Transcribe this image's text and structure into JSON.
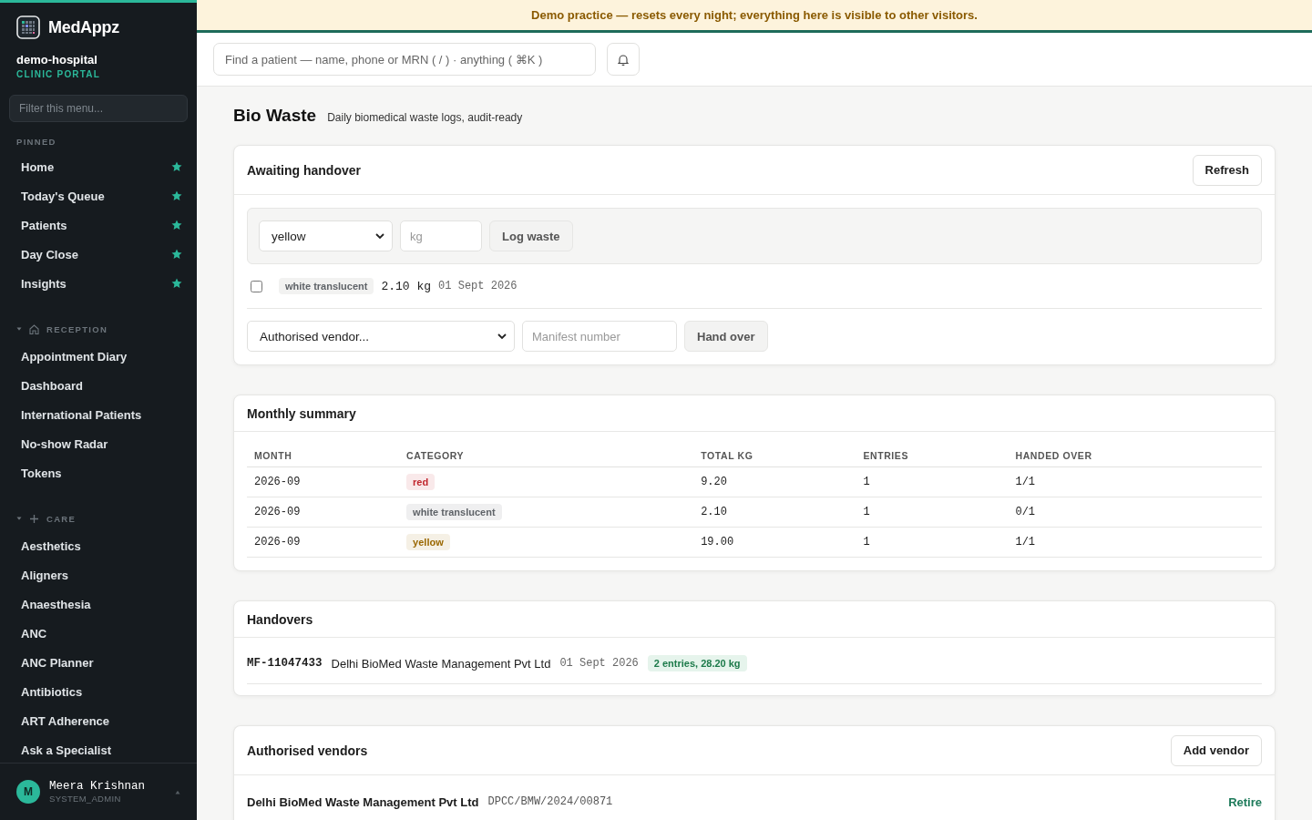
{
  "brand": {
    "name": "MedAppz"
  },
  "sidebar": {
    "org": "demo-hospital",
    "portal": "CLINIC PORTAL",
    "filter_placeholder": "Filter this menu...",
    "pinned_label": "PINNED",
    "pinned": [
      {
        "label": "Home"
      },
      {
        "label": "Today's Queue"
      },
      {
        "label": "Patients"
      },
      {
        "label": "Day Close"
      },
      {
        "label": "Insights"
      }
    ],
    "sections": [
      {
        "title": "RECEPTION",
        "kind": "home",
        "expanded": true,
        "items": [
          {
            "label": "Appointment Diary"
          },
          {
            "label": "Dashboard"
          },
          {
            "label": "International Patients"
          },
          {
            "label": "No-show Radar"
          },
          {
            "label": "Tokens"
          }
        ]
      },
      {
        "title": "CARE",
        "kind": "plus",
        "expanded": true,
        "items": [
          {
            "label": "Aesthetics"
          },
          {
            "label": "Aligners"
          },
          {
            "label": "Anaesthesia"
          },
          {
            "label": "ANC"
          },
          {
            "label": "ANC Planner"
          },
          {
            "label": "Antibiotics"
          },
          {
            "label": "ART Adherence"
          },
          {
            "label": "Ask a Specialist"
          }
        ]
      }
    ],
    "user": {
      "initial": "M",
      "name": "Meera Krishnan",
      "role": "SYSTEM_ADMIN"
    }
  },
  "banner": "Demo practice — resets every night; everything here is visible to other visitors.",
  "topbar": {
    "search_placeholder": "Find a patient — name, phone or MRN ( / ) · anything ( ⌘K )"
  },
  "page": {
    "title": "Bio Waste",
    "subtitle": "Daily biomedical waste logs, audit-ready"
  },
  "awaiting": {
    "title": "Awaiting handover",
    "refresh": "Refresh",
    "category": "yellow",
    "kg_placeholder": "kg",
    "log_button": "Log waste",
    "entries": [
      {
        "checked": false,
        "category": "white translucent",
        "color": "#5f6368",
        "kg": "2.10 kg",
        "date": "01 Sept 2026"
      }
    ],
    "vendor_select": "Authorised vendor...",
    "manifest_placeholder": "Manifest number",
    "handover_button": "Hand over"
  },
  "summary": {
    "title": "Monthly summary",
    "columns": [
      "MONTH",
      "CATEGORY",
      "TOTAL KG",
      "ENTRIES",
      "HANDED OVER"
    ],
    "rows": [
      {
        "month": "2026-09",
        "category": "red",
        "color": "#c0262d",
        "total_kg": "9.20",
        "entries": "1",
        "handed_over": "1/1"
      },
      {
        "month": "2026-09",
        "category": "white translucent",
        "color": "#5f6368",
        "total_kg": "2.10",
        "entries": "1",
        "handed_over": "0/1"
      },
      {
        "month": "2026-09",
        "category": "yellow",
        "color": "#9a6700",
        "total_kg": "19.00",
        "entries": "1",
        "handed_over": "1/1"
      }
    ]
  },
  "handovers": {
    "title": "Handovers",
    "items": [
      {
        "manifest": "MF-11047433",
        "vendor": "Delhi BioMed Waste Management Pvt Ltd",
        "date": "01 Sept 2026",
        "summary": "2 entries, 28.20 kg"
      }
    ]
  },
  "vendors": {
    "title": "Authorised vendors",
    "add_button": "Add vendor",
    "items": [
      {
        "name": "Delhi BioMed Waste Management Pvt Ltd",
        "registration": "DPCC/BMW/2024/00871",
        "action": "Retire"
      }
    ]
  }
}
